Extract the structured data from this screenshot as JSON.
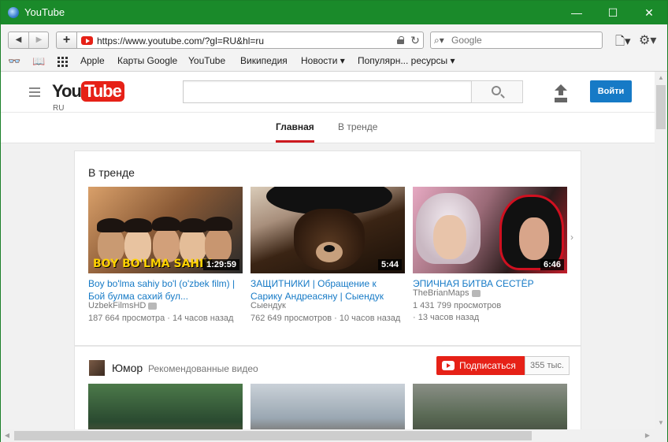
{
  "window": {
    "title": "YouTube",
    "minimize": "—",
    "maximize": "☐",
    "close": "✕"
  },
  "toolbar": {
    "back": "◀",
    "forward": "▶",
    "add": "+",
    "url": "https://www.youtube.com/?gl=RU&hl=ru",
    "reload": "↻",
    "search_placeholder": "Google",
    "search_glyph": "⌕▾",
    "page_menu": "🗋▾",
    "settings_menu": "⚙▾"
  },
  "bookmarks": {
    "reader_glyph": "👓",
    "book_glyph": "📖",
    "items": [
      "Apple",
      "Карты Google",
      "YouTube",
      "Википедия",
      "Новости ▾",
      "Популярн... ресурсы ▾"
    ]
  },
  "yt": {
    "logo_you": "You",
    "logo_tube": "Tube",
    "region": "RU",
    "signin": "Войти",
    "tabs": [
      "Главная",
      "В тренде"
    ],
    "trending": {
      "title": "В тренде",
      "videos": [
        {
          "title": "Boy bo'lma sahiy bo'l (o'zbek film) | Бой булма сахий бул...",
          "channel": "UzbekFilmsHD",
          "views": "187 664 просмотра",
          "age": "14 часов назад",
          "duration": "1:29:59",
          "banner": "BOY BO'LMA SAHIY"
        },
        {
          "title": "ЗАЩИТНИКИ | Обращение к Сарику Андреасяну | Сыендук",
          "channel": "Сыендук",
          "views": "762 649 просмотров",
          "age": "10 часов назад",
          "duration": "5:44"
        },
        {
          "title": "ЭПИЧНАЯ БИТВА СЕСТЁР",
          "channel": "TheBrianMaps",
          "views": "1 431 799 просмотров",
          "age": "13 часов назад",
          "duration": "6:46"
        }
      ],
      "next": "›"
    },
    "humor": {
      "title": "Юмор",
      "subtitle": "Рекомендованные видео",
      "subscribe": "Подписаться",
      "subcount": "355 тыс."
    }
  },
  "scroll": {
    "up": "▲",
    "down": "▼",
    "left": "◀",
    "right": "▶"
  }
}
